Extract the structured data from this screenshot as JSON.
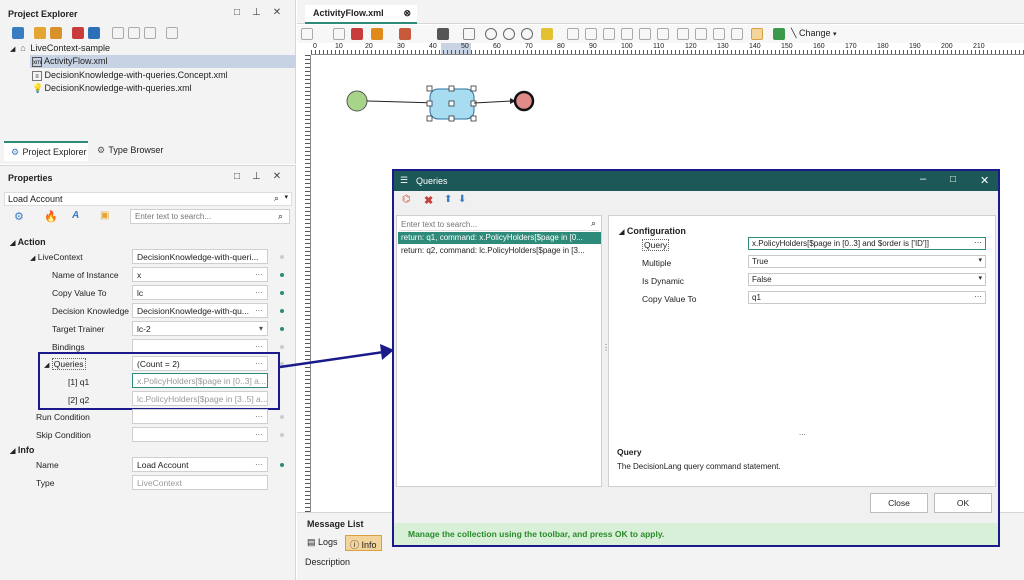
{
  "project_explorer": {
    "title": "Project Explorer",
    "tree": [
      {
        "label": "LiveContext-sample",
        "icon": "home-icon"
      },
      {
        "label": "ActivityFlow.xml",
        "icon": "xml-file-icon",
        "selected": true
      },
      {
        "label": "DecisionKnowledge-with-queries.Concept.xml",
        "icon": "concept-file-icon"
      },
      {
        "label": "DecisionKnowledge-with-queries.xml",
        "icon": "bulb-icon"
      }
    ],
    "tabs": [
      "Project Explorer",
      "Type Browser"
    ]
  },
  "properties": {
    "title": "Properties",
    "object": "Load Account",
    "search_placeholder": "Enter text to search...",
    "action_section": "Action",
    "info_section": "Info",
    "rows": [
      {
        "label": "LiveContext",
        "value": "DecisionKnowledge-with-queri..."
      },
      {
        "label": "Name of Instance",
        "value": "x"
      },
      {
        "label": "Copy Value To",
        "value": "lc"
      },
      {
        "label": "Decision Knowledge",
        "value": "DecisionKnowledge-with-qu..."
      },
      {
        "label": "Target Trainer",
        "value": "lc-2"
      },
      {
        "label": "Bindings",
        "value": ""
      },
      {
        "label": "Queries",
        "value": "(Count = 2)"
      },
      {
        "label": "[1] q1",
        "value": "x.PolicyHolders[$page in [0..3] a..."
      },
      {
        "label": "[2] q2",
        "value": "lc.PolicyHolders[$page in [3..5] a..."
      },
      {
        "label": "Run Condition",
        "value": ""
      },
      {
        "label": "Skip Condition",
        "value": ""
      },
      {
        "label": "Name",
        "value": "Load Account"
      },
      {
        "label": "Type",
        "value": "LiveContext"
      }
    ]
  },
  "editor": {
    "tab": "ActivityFlow.xml",
    "change_label": "Change",
    "ruler": [
      "0",
      "10",
      "20",
      "30",
      "40",
      "50",
      "60",
      "70",
      "80",
      "90",
      "100",
      "110",
      "120",
      "130",
      "140",
      "150",
      "160",
      "170",
      "180",
      "190",
      "200",
      "210"
    ]
  },
  "message_list": {
    "title": "Message List",
    "logs_label": "Logs",
    "info_label": "Info",
    "description_header": "Description"
  },
  "dialog": {
    "title": "Queries",
    "search_placeholder": "Enter text to search...",
    "items": [
      "return: q1, command: x.PolicyHolders[$page in [0...",
      "return: q2, command: lc.PolicyHolders[$page in [3..."
    ],
    "section": "Configuration",
    "fields": [
      {
        "label": "Query",
        "value": "x.PolicyHolders[$page in [0..3] and $order is ['ID']]"
      },
      {
        "label": "Multiple",
        "value": "True"
      },
      {
        "label": "Is Dynamic",
        "value": "False"
      },
      {
        "label": "Copy Value To",
        "value": "q1"
      }
    ],
    "ellipsis": "...",
    "help_title": "Query",
    "help_text": "The DecisionLang query command statement.",
    "close_label": "Close",
    "ok_label": "OK",
    "footer": "Manage the collection using the toolbar, and press OK to apply."
  },
  "colors": {
    "accent": "#2e8b7a",
    "dialog_header": "#1d5858",
    "dialog_border": "#1a1a8c",
    "footer_text": "#2a8a2a"
  }
}
